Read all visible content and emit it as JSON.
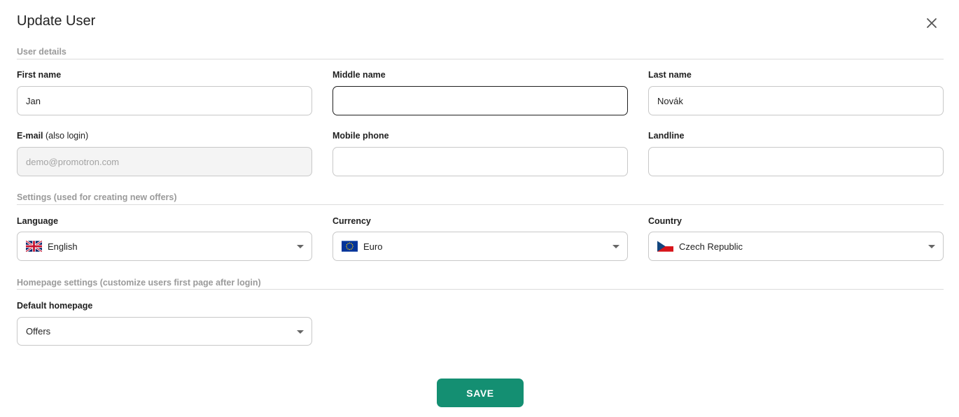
{
  "dialog": {
    "title": "Update User",
    "close_icon": "close-icon"
  },
  "sections": {
    "user_details": "User details",
    "settings": "Settings (used for creating new offers)",
    "homepage": "Homepage settings (customize users first page after login)"
  },
  "fields": {
    "first_name": {
      "label": "First name",
      "value": "Jan"
    },
    "middle_name": {
      "label": "Middle name",
      "value": ""
    },
    "last_name": {
      "label": "Last name",
      "value": "Novák"
    },
    "email": {
      "label": "E-mail",
      "label_note": "(also login)",
      "value": "demo@promotron.com",
      "disabled": true
    },
    "mobile_phone": {
      "label": "Mobile phone",
      "value": ""
    },
    "landline": {
      "label": "Landline",
      "value": ""
    }
  },
  "settings": {
    "language": {
      "label": "Language",
      "value": "English",
      "flag": "uk-flag-icon"
    },
    "currency": {
      "label": "Currency",
      "value": "Euro",
      "flag": "eu-flag-icon"
    },
    "country": {
      "label": "Country",
      "value": "Czech Republic",
      "flag": "czech-flag-icon"
    }
  },
  "homepage": {
    "label": "Default homepage",
    "value": "Offers"
  },
  "actions": {
    "save_label": "SAVE"
  },
  "colors": {
    "accent": "#148f72",
    "section_text": "#9a9a9a",
    "border": "#c8c8c8"
  }
}
